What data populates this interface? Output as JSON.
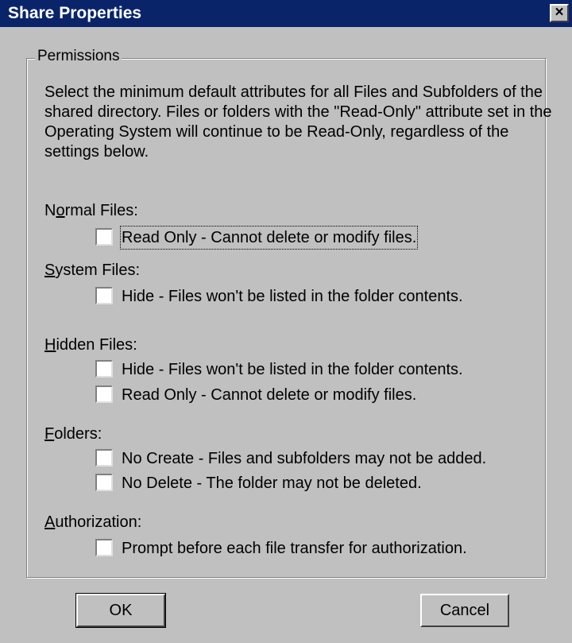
{
  "window": {
    "title": "Share Properties",
    "close_glyph": "×"
  },
  "group": {
    "legend": "Permissions",
    "description": "Select the minimum default attributes for all Files and Subfolders of the shared directory.  Files or folders with the \"Read-Only\" attribute set in the Operating System will continue to be Read-Only, regardless of the settings below."
  },
  "sections": [
    {
      "label_prefix": "N",
      "label_u": "o",
      "label_rest": "rmal Files:",
      "options": [
        {
          "label": "Read Only - Cannot delete or modify files.",
          "checked": false,
          "focused": true
        }
      ]
    },
    {
      "label_prefix": "",
      "label_u": "S",
      "label_rest": "ystem Files:",
      "options": [
        {
          "label": "Hide - Files won't be listed in the folder contents.",
          "checked": false
        }
      ]
    },
    {
      "label_prefix": "",
      "label_u": "H",
      "label_rest": "idden Files:",
      "options": [
        {
          "label": "Hide - Files won't be listed in the folder contents.",
          "checked": false
        },
        {
          "label": "Read Only - Cannot delete or modify files.",
          "checked": false
        }
      ]
    },
    {
      "label_prefix": "",
      "label_u": "F",
      "label_rest": "olders:",
      "options": [
        {
          "label": "No Create - Files and subfolders may not be added.",
          "checked": false
        },
        {
          "label": "No Delete - The folder may not be deleted.",
          "checked": false
        }
      ]
    },
    {
      "label_prefix": "",
      "label_u": "A",
      "label_rest": "uthorization:",
      "options": [
        {
          "label": "Prompt before each file transfer for authorization.",
          "checked": false
        }
      ]
    }
  ],
  "buttons": {
    "ok": "OK",
    "cancel": "Cancel"
  },
  "colors": {
    "titlebar": "#0a246a",
    "face": "#c0c0c0"
  }
}
